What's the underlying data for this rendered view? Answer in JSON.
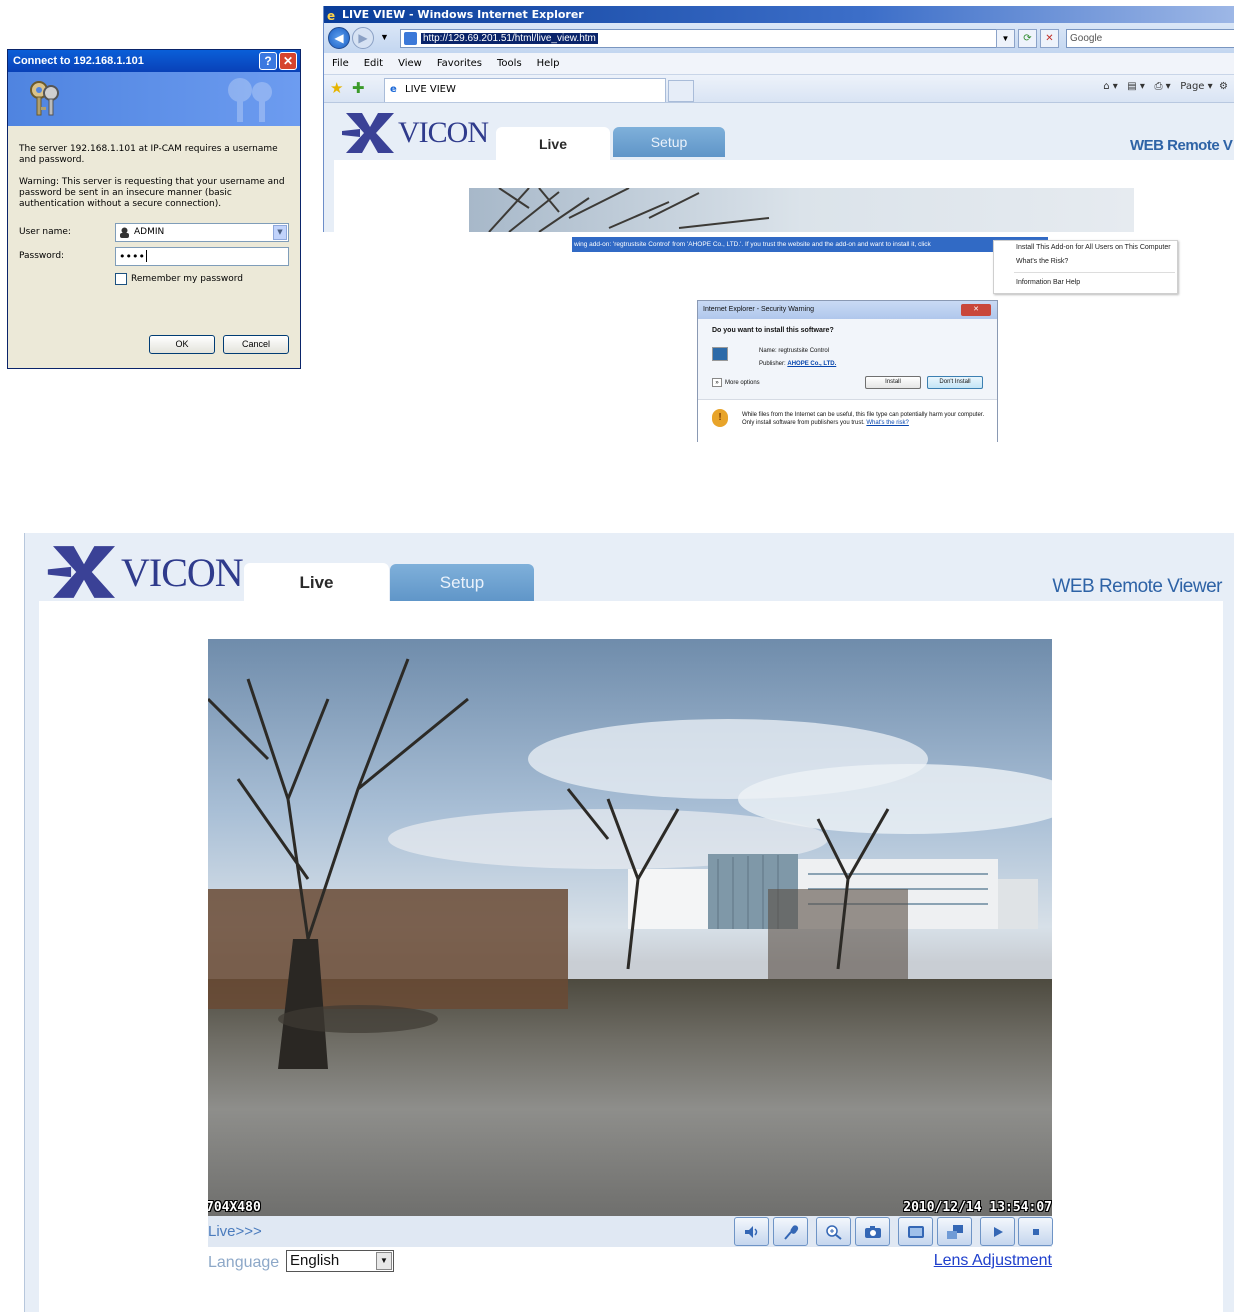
{
  "login_dialog": {
    "title": "Connect to 192.168.1.101",
    "help_label": "?",
    "close_label": "✕",
    "message": "The server 192.168.1.101 at IP-CAM requires a username and password.",
    "warning": "Warning: This server is requesting that your username and password be sent in an insecure manner (basic authentication without a secure connection).",
    "username_label": "User name:",
    "username_value": "ADMIN",
    "password_label": "Password:",
    "password_value": "••••",
    "remember_label": "Remember my password",
    "ok_label": "OK",
    "cancel_label": "Cancel"
  },
  "browser": {
    "window_title": "LIVE VIEW - Windows Internet Explorer",
    "url": "http://129.69.201.51/html/live_view.htm",
    "search_placeholder": "Google",
    "menu": [
      "File",
      "Edit",
      "View",
      "Favorites",
      "Tools",
      "Help"
    ],
    "tab_title": "LIVE VIEW",
    "page_label": "Page"
  },
  "header": {
    "logo_text": "VICON",
    "tab_live": "Live",
    "tab_setup": "Setup",
    "app_title_short": "WEB Remote V",
    "app_title": "WEB Remote Viewer"
  },
  "info_bar": {
    "text": "wing add-on: 'regtrustsite Control' from 'AHOPE Co., LTD.'. If you trust the website and the add-on and want to install it, click"
  },
  "context_menu": {
    "items": [
      "Install This Add-on for All Users on This Computer",
      "What's the Risk?",
      "Information Bar Help"
    ]
  },
  "security_warning": {
    "title": "Internet Explorer - Security Warning",
    "question": "Do you want to install this software?",
    "name_label": "Name:",
    "name_value": "regtrustsite Control",
    "publisher_label": "Publisher:",
    "publisher_value": "AHOPE Co., LTD.",
    "more_options": "More options",
    "install_label": "Install",
    "dont_install_label": "Don't Install",
    "footer_text": "While files from the Internet can be useful, this file type can potentially harm your computer. Only install software from publishers you trust.",
    "risk_link": "What's the risk?"
  },
  "live_view": {
    "resolution_osd": "704X480",
    "timestamp_osd": "2010/12/14 13:54:07",
    "live_label": "Live>>>",
    "language_label": "Language",
    "language_value": "English",
    "lens_link": "Lens Adjustment",
    "controls": [
      "speaker-icon",
      "microphone-icon",
      "zoom-icon",
      "camera-icon",
      "fullscreen-icon",
      "picture-in-picture-icon",
      "play-icon",
      "stop-icon"
    ]
  },
  "colors": {
    "accent_blue": "#2e63a6",
    "setup_tab": "#6a9ecf",
    "link": "#1f3fcc",
    "xp_title": "#0a5fd8"
  }
}
